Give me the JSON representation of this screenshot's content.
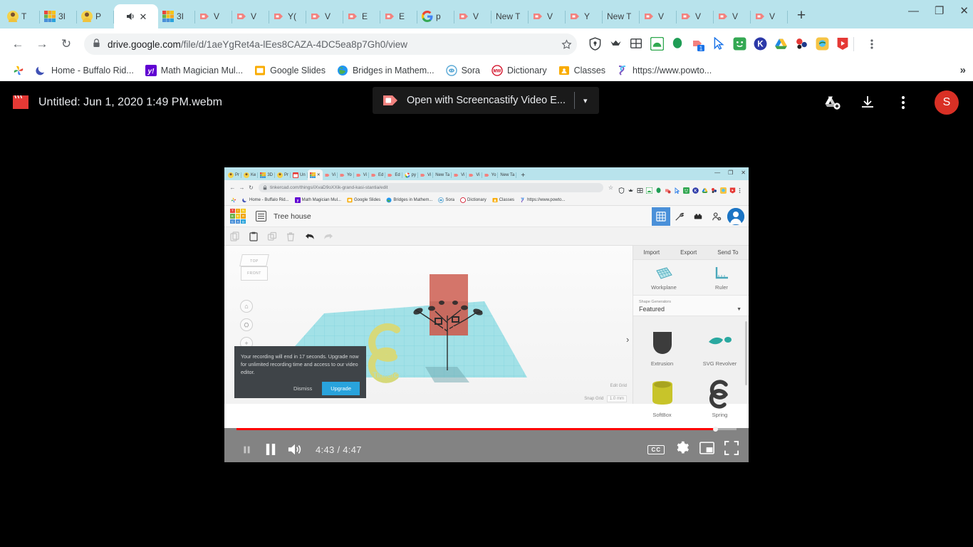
{
  "browser": {
    "tabs": [
      {
        "favicon": "user-avatar",
        "label": "T"
      },
      {
        "favicon": "tinkercad",
        "label": "3I"
      },
      {
        "favicon": "user-avatar",
        "label": "P"
      },
      {
        "favicon": "speaker-playing",
        "label": "",
        "active": true,
        "close": "✕"
      },
      {
        "favicon": "tinkercad",
        "label": "3I"
      },
      {
        "favicon": "screencastify",
        "label": "V"
      },
      {
        "favicon": "screencastify",
        "label": "V"
      },
      {
        "favicon": "screencastify",
        "label": "Y("
      },
      {
        "favicon": "screencastify",
        "label": "V"
      },
      {
        "favicon": "screencastify",
        "label": "E"
      },
      {
        "favicon": "screencastify",
        "label": "E"
      },
      {
        "favicon": "google",
        "label": "p"
      },
      {
        "favicon": "screencastify",
        "label": "V"
      },
      {
        "favicon": "none",
        "label": "New T"
      },
      {
        "favicon": "screencastify",
        "label": "V"
      },
      {
        "favicon": "screencastify",
        "label": "Y"
      },
      {
        "favicon": "none",
        "label": "New T"
      },
      {
        "favicon": "screencastify",
        "label": "V"
      },
      {
        "favicon": "screencastify",
        "label": "V"
      },
      {
        "favicon": "screencastify",
        "label": "V"
      },
      {
        "favicon": "screencastify",
        "label": "V"
      }
    ],
    "new_tab_label": "+",
    "window_controls": [
      "—",
      "❐",
      "✕"
    ],
    "nav": {
      "back": "←",
      "forward": "→",
      "reload": "↻"
    },
    "omnibox": {
      "lock_icon": "lock-icon",
      "url_host": "drive.google.com",
      "url_path": "/file/d/1aeYgRet4a-lEes8CAZA-4DC5ea8p7Gh0/view",
      "star_icon": "star-icon"
    },
    "extensions": [
      "shield-icon",
      "crown-icon",
      "grid-icon",
      "green-arch-icon",
      "green-balloon-icon",
      "screencastify-icon-badge",
      "cursor-icon",
      "green-smiley-icon",
      "kami-icon",
      "google-drive-icon",
      "molecule-icon",
      "yellow-globe-icon",
      "red-video-icon"
    ],
    "extension_badge": "1",
    "menu_icon": "kebab-menu-icon",
    "bookmarks": [
      {
        "icon": "photos-icon",
        "label": ""
      },
      {
        "icon": "moon-icon",
        "label": "Home - Buffalo Rid..."
      },
      {
        "icon": "yahoo-icon",
        "label": "Math Magician Mul..."
      },
      {
        "icon": "slides-icon",
        "label": "Google Slides"
      },
      {
        "icon": "globe-icon",
        "label": "Bridges in Mathem..."
      },
      {
        "icon": "sora-icon",
        "label": "Sora"
      },
      {
        "icon": "merriam-icon",
        "label": "Dictionary"
      },
      {
        "icon": "classroom-icon",
        "label": "Classes"
      },
      {
        "icon": "powtoon-icon",
        "label": "https://www.powto..."
      }
    ],
    "bookmarks_overflow": "»"
  },
  "drive": {
    "file_icon": "film-clapper-icon",
    "file_name": "Untitled: Jun 1, 2020 1:49 PM.webm",
    "open_with": {
      "icon": "screencastify-icon",
      "label": "Open with Screencastify Video E...",
      "caret": "▾"
    },
    "actions": [
      {
        "icon": "add-to-drive-icon"
      },
      {
        "icon": "download-icon"
      },
      {
        "icon": "more-options-icon"
      }
    ],
    "avatar_initial": "S"
  },
  "video": {
    "inner_browser": {
      "tabs": [
        {
          "favicon": "user-avatar",
          "label": "Pr"
        },
        {
          "favicon": "user-avatar",
          "label": "Ke"
        },
        {
          "favicon": "tinkercad",
          "label": "3D"
        },
        {
          "favicon": "user-avatar",
          "label": "Pr"
        },
        {
          "favicon": "red-calendar",
          "label": "Un"
        },
        {
          "favicon": "tinkercad",
          "label": "",
          "active": true,
          "close": "✕"
        },
        {
          "favicon": "screencastify",
          "label": "Vi"
        },
        {
          "favicon": "screencastify",
          "label": "Yo"
        },
        {
          "favicon": "screencastify",
          "label": "Vi"
        },
        {
          "favicon": "screencastify",
          "label": "Ed"
        },
        {
          "favicon": "screencastify",
          "label": "Ed"
        },
        {
          "favicon": "google",
          "label": "py"
        },
        {
          "favicon": "screencastify",
          "label": "Vi"
        },
        {
          "favicon": "none",
          "label": "New Ta"
        },
        {
          "favicon": "screencastify",
          "label": "Vi"
        },
        {
          "favicon": "screencastify",
          "label": "Vi"
        },
        {
          "favicon": "screencastify",
          "label": "Yo"
        },
        {
          "favicon": "none",
          "label": "New Ta"
        }
      ],
      "new_tab_label": "+",
      "window_controls": [
        "—",
        "❐",
        "✕"
      ],
      "url": "tinkercad.com/things/iXvaD9oXXik-grand-kasi-stantia/edit",
      "bookmarks": [
        {
          "icon": "photos-icon",
          "label": ""
        },
        {
          "icon": "moon-icon",
          "label": "Home - Buffalo Rid..."
        },
        {
          "icon": "yahoo-icon",
          "label": "Math Magician Mul..."
        },
        {
          "icon": "slides-icon",
          "label": "Google Slides"
        },
        {
          "icon": "globe-icon",
          "label": "Bridges in Mathem..."
        },
        {
          "icon": "sora-icon",
          "label": "Sora"
        },
        {
          "icon": "merriam-icon",
          "label": "Dictionary"
        },
        {
          "icon": "classroom-icon",
          "label": "Classes"
        },
        {
          "icon": "powtoon-icon",
          "label": "https://www.powto..."
        }
      ]
    },
    "tinkercad": {
      "logo_letters": [
        "T",
        "I",
        "N",
        "K",
        "E",
        "R",
        "C",
        "A",
        "D"
      ],
      "logo_colors": [
        "#e8453c",
        "#f0a30a",
        "#f5c518",
        "#6ab04c",
        "#f5c518",
        "#f0a30a",
        "#4a90d9",
        "#4a90d9",
        "#29a3dc"
      ],
      "project_name": "Tree house",
      "toolbar_icons": [
        "copy-icon",
        "paste-icon",
        "duplicate-icon",
        "delete-icon",
        "undo-icon",
        "redo-icon"
      ],
      "mode_icons": [
        "grid-mode-icon",
        "tools-mode-icon",
        "blocks-mode-icon",
        "person-add-icon"
      ],
      "panel_tabs": [
        "Import",
        "Export",
        "Send To"
      ],
      "helpers": [
        {
          "icon": "workplane-icon",
          "label": "Workplane"
        },
        {
          "icon": "ruler-icon",
          "label": "Ruler"
        }
      ],
      "shape_generators_label": "Shape Generators",
      "shape_generators_value": "Featured",
      "shapes": [
        {
          "name": "Extrusion",
          "color": "#3c3c3c"
        },
        {
          "name": "SVG Revolver",
          "color": "#2aa8a0"
        },
        {
          "name": "SoftBox",
          "color": "#c8c42a"
        },
        {
          "name": "Spring",
          "color": "#3c3c3c"
        }
      ],
      "viewcube": {
        "top": "TOP",
        "front": "FRONT"
      },
      "nav_buttons": [
        "home-view-icon",
        "fit-view-icon",
        "zoom-in-icon",
        "zoom-out-icon"
      ],
      "edit_grid_label": "Edit Grid",
      "snap_grid_label": "Snap Grid",
      "snap_grid_value": "1.0 mm"
    },
    "toast": {
      "message": "Your recording will end in 17 seconds. Upgrade now for unlimited recording time and access to our video editor.",
      "dismiss_label": "Dismiss",
      "upgrade_label": "Upgrade",
      "upgrade_color": "#29a3dc"
    },
    "controls": {
      "play_pause_icon": "pause-icon",
      "volume_icon": "volume-high-icon",
      "current_time": "4:43",
      "duration": "4:47",
      "time_separator": "/",
      "cc_label": "CC",
      "settings_icon": "gear-icon",
      "miniplayer_icon": "miniplayer-icon",
      "fullscreen_icon": "fullscreen-icon",
      "progress_percent": 96,
      "progress_color": "#ff0000"
    }
  },
  "colors": {
    "tab_strip": "#b8e3ec",
    "drive_background": "#000000",
    "avatar": "#d93025",
    "accent_blue": "#29a3dc"
  }
}
